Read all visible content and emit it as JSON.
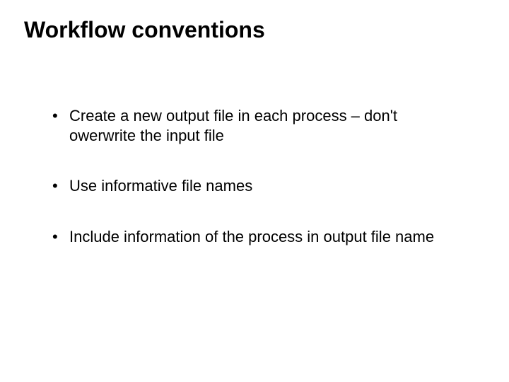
{
  "slide": {
    "title": "Workflow conventions",
    "bullets": [
      "Create a new output file in each process – don't owerwrite the input file",
      "Use informative file names",
      "Include information of the process in output file name"
    ]
  }
}
